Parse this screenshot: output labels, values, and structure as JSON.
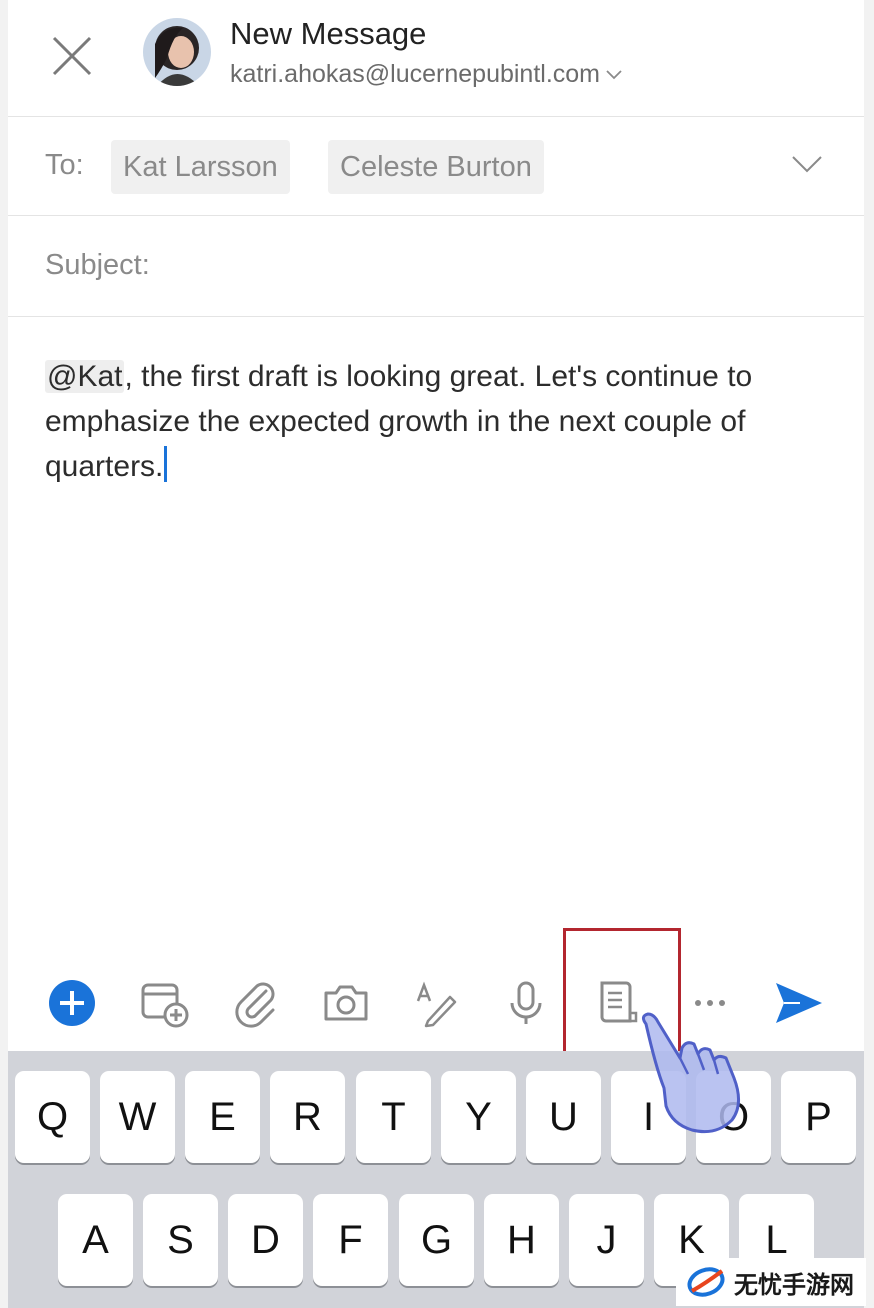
{
  "header": {
    "title": "New Message",
    "sender_email": "katri.ahokas@lucernepubintl.com"
  },
  "recipients": {
    "to_label": "To:",
    "chips": [
      "Kat Larsson",
      "Celeste Burton"
    ]
  },
  "subject": {
    "label": "Subject:"
  },
  "body": {
    "mention": "@Kat",
    "text": ", the first draft is looking great. Let's continue to emphasize the expected growth in the next couple of quarters."
  },
  "toolbar": {
    "icons": [
      "add-icon",
      "calendar-add-icon",
      "attach-icon",
      "camera-icon",
      "draw-icon",
      "microphone-icon",
      "template-icon",
      "more-icon",
      "send-icon"
    ],
    "accent_color": "#1a73d9",
    "highlight_color": "#b3262f"
  },
  "keyboard": {
    "row1": [
      "Q",
      "W",
      "E",
      "R",
      "T",
      "Y",
      "U",
      "I",
      "O",
      "P"
    ],
    "row2": [
      "A",
      "S",
      "D",
      "F",
      "G",
      "H",
      "J",
      "K",
      "L"
    ]
  },
  "watermark": {
    "text": "无忧手游网"
  }
}
